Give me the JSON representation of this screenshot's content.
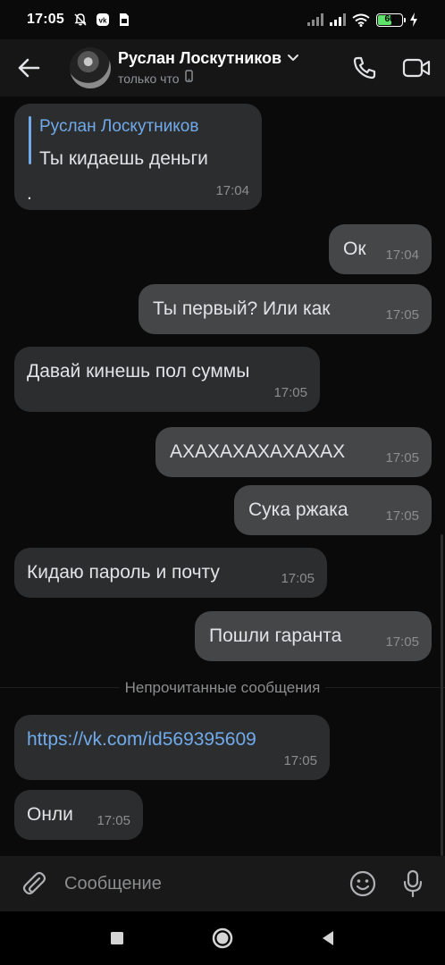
{
  "status_bar": {
    "time": "17:05",
    "battery_level": "60",
    "battery_fraction": 0.6,
    "left_icons": [
      "bell-off-icon",
      "vk-icon",
      "sim-icon"
    ],
    "right_icons": [
      "signal-icon",
      "signal-icon",
      "wifi-icon",
      "battery-icon",
      "charging-icon"
    ]
  },
  "header": {
    "contact_name": "Руслан Лоскутников",
    "status": "только что",
    "icons": [
      "back-arrow-icon",
      "chevron-down-icon",
      "phone-icon",
      "video-icon",
      "mobile-device-icon"
    ]
  },
  "messages": [
    {
      "dir": "in",
      "reply_to": "Руслан Лоскутников",
      "text": "Ты кидаешь деньги",
      "extra": ".",
      "time": "17:04"
    },
    {
      "dir": "out",
      "text": "Ок",
      "time": "17:04"
    },
    {
      "dir": "out",
      "text": "Ты первый? Или как",
      "time": "17:05"
    },
    {
      "dir": "in",
      "text": "Давай кинешь пол суммы",
      "time": "17:05"
    },
    {
      "dir": "out",
      "text": "АХАХАХАХАХАХАХ",
      "time": "17:05"
    },
    {
      "dir": "out",
      "text": "Сука ржака",
      "time": "17:05"
    },
    {
      "dir": "in",
      "text": "Кидаю пароль и почту",
      "time": "17:05"
    },
    {
      "dir": "out",
      "text": "Пошли гаранта",
      "time": "17:05"
    },
    {
      "dir": "in",
      "text": "https://vk.com/id569395609",
      "time": "17:05",
      "is_link": true
    },
    {
      "dir": "in",
      "text": "Онли",
      "time": "17:05"
    }
  ],
  "unread_divider": "Непрочитанные сообщения",
  "composer": {
    "placeholder": "Сообщение",
    "icons": [
      "paperclip-icon",
      "emoji-icon",
      "microphone-icon"
    ]
  },
  "navbar": {
    "icons": [
      "recents-square-icon",
      "home-circle-icon",
      "back-triangle-icon"
    ]
  },
  "colors": {
    "background": "#0a0a0a",
    "incoming_bubble": "#2c2d2e",
    "outgoing_bubble": "#454647",
    "link": "#71aaeb",
    "battery_green": "#5ee36a"
  }
}
